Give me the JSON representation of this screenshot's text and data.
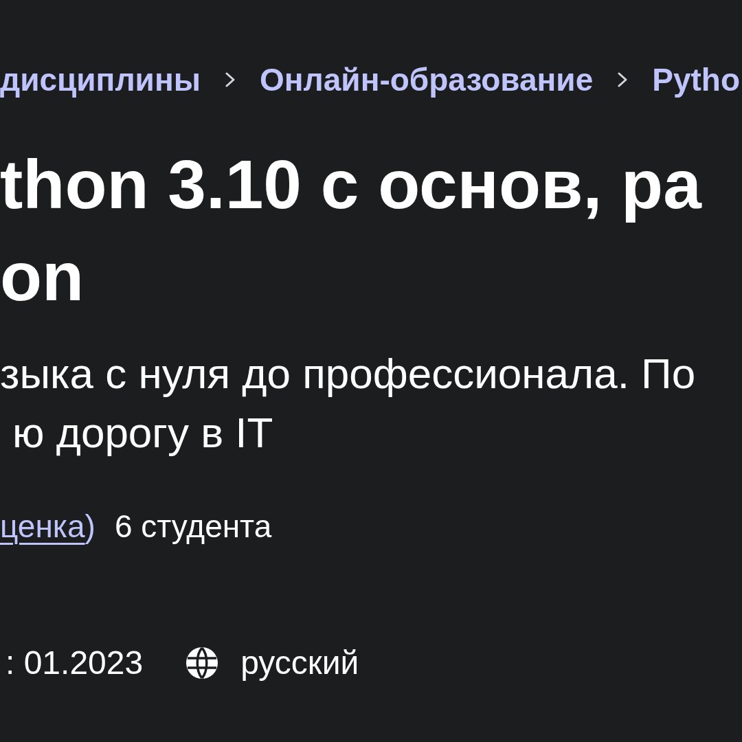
{
  "breadcrumb": [
    {
      "label": "дисциплины"
    },
    {
      "label": "Онлайн-образование"
    },
    {
      "label": "Pytho"
    }
  ],
  "title_lines": [
    "thon 3.10 с основ, ра",
    "on"
  ],
  "subtitle_lines": [
    "зыка с нуля до профессионала. По",
    "ю дорогу в IT"
  ],
  "rating": {
    "link": "ценка",
    "suffix": ")",
    "students": "6 студента"
  },
  "meta": {
    "updated": ": 01.2023",
    "language": "русский"
  }
}
